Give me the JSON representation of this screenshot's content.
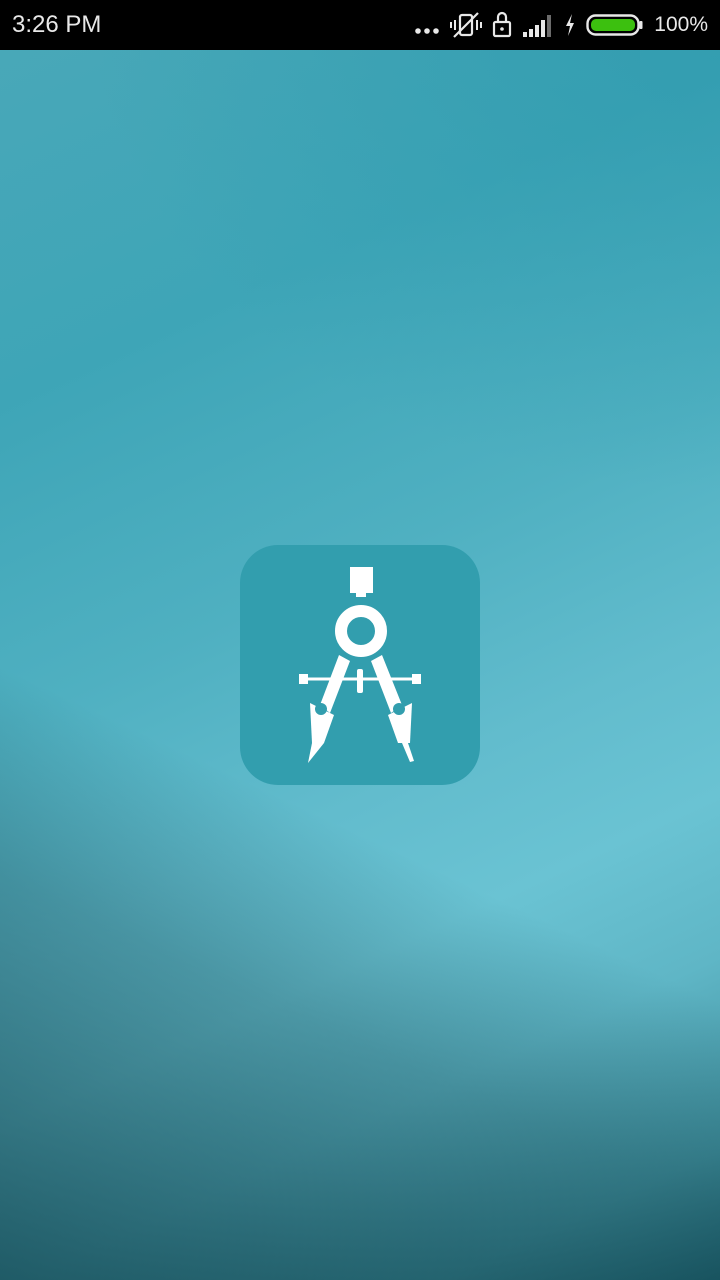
{
  "status_bar": {
    "time": "3:26 PM",
    "battery_percent": "100%",
    "battery_level": 1.0,
    "battery_color": "#3cc00f",
    "icons": [
      "more-dots-icon",
      "vibrate-off-icon",
      "lock-icon",
      "signal-icon",
      "charging-icon",
      "battery-icon"
    ]
  },
  "splash": {
    "logo_icon": "drafting-compass-icon",
    "tile_color": "#329eae"
  }
}
